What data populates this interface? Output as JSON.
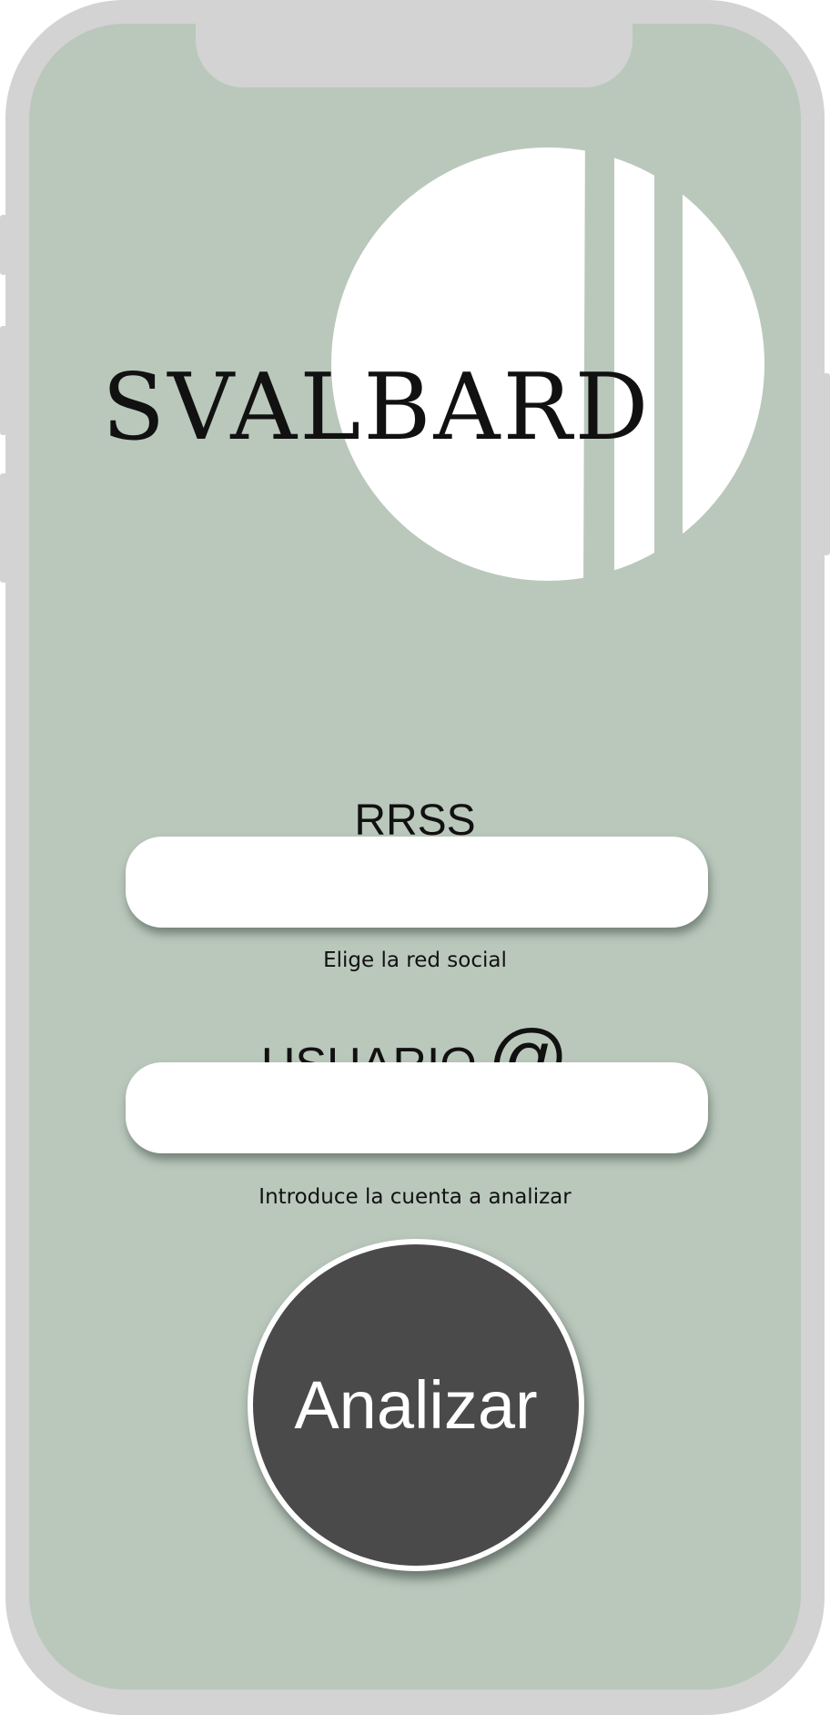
{
  "app": {
    "brand_name": "SVALBARD",
    "logo": "svalbard-striped-circle-logo"
  },
  "form": {
    "rrss": {
      "label": "RRSS",
      "value": "",
      "helper": "Elige la red social"
    },
    "usuario": {
      "label": "USUARIO",
      "at_symbol": "@",
      "value": "",
      "helper": "Introduce la cuenta a analizar"
    },
    "analyze_label": "Analizar"
  },
  "colors": {
    "screen_background": "#bac8bc",
    "device_frame": "#d3d3d3",
    "button_fill": "#4a4a4a",
    "logo_fill": "#ffffff",
    "text": "#111111"
  }
}
